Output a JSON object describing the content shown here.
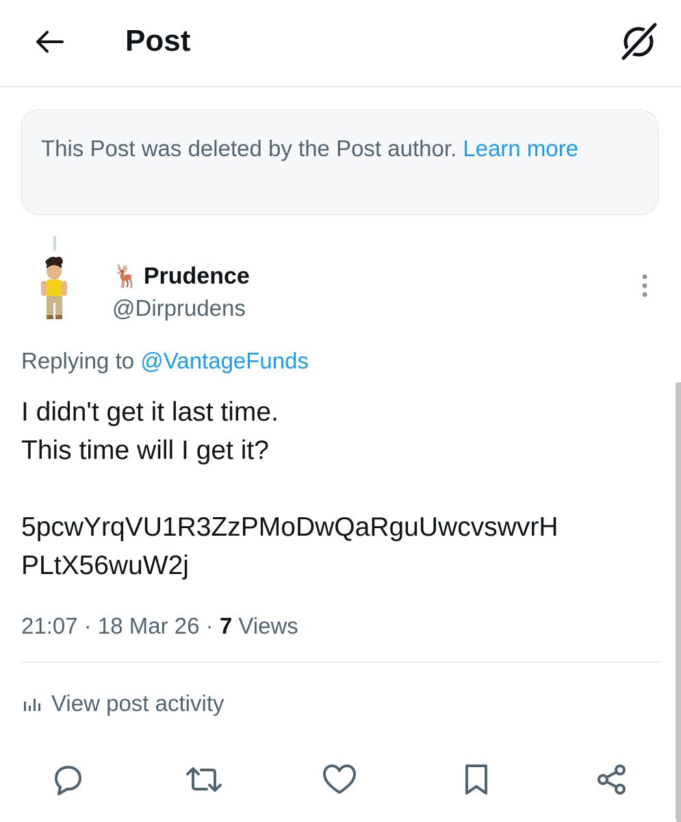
{
  "header": {
    "title": "Post",
    "back_icon": "arrow-left-icon",
    "grok_icon": "grok-icon"
  },
  "deleted_notice": {
    "text": "This Post was deleted by the Post author.",
    "link": "Learn more"
  },
  "author": {
    "emoji": "🦌",
    "name": "Prudence",
    "handle": "@Dirprudens"
  },
  "reply": {
    "prefix": "Replying to",
    "target": "@VantageFunds"
  },
  "post": {
    "line1": "I didn't get it last time.",
    "line2": "This time will I get it?",
    "code_line1": "5pcwYrqVU1R3ZzPMoDwQaRguUwcvswvrH",
    "code_line2": "PLtX56wuW2j"
  },
  "meta": {
    "time": "21:07",
    "date": "18 Mar 26",
    "views_count": "7",
    "views_label": "Views"
  },
  "activity": {
    "label": "View post activity",
    "icon": "bar-chart-icon"
  },
  "colors": {
    "link": "#1d9bf0",
    "secondary_text": "#536471",
    "primary_text": "#0f1419"
  }
}
